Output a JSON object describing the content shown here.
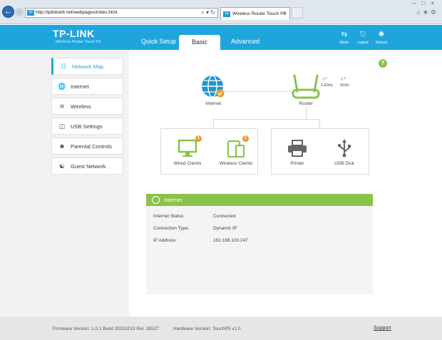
{
  "browser": {
    "url": "http://tplinkwifi.net/webpages/index.html",
    "tab_title": "Wireless Router Touch P5",
    "favicon_text": "TP"
  },
  "header": {
    "logo": "TP-LINK",
    "model": "Wireless Router Touch P5",
    "tabs": [
      "Quick Setup",
      "Basic",
      "Advanced"
    ],
    "tools": [
      {
        "label": "Mode",
        "icon": "mode-icon"
      },
      {
        "label": "Logout",
        "icon": "logout-icon"
      },
      {
        "label": "Reboot",
        "icon": "reboot-icon"
      }
    ]
  },
  "sidebar": {
    "items": [
      {
        "label": "Network Map",
        "icon": "network-map-icon",
        "active": true
      },
      {
        "label": "Internet",
        "icon": "globe-icon"
      },
      {
        "label": "Wireless",
        "icon": "wireless-icon"
      },
      {
        "label": "USB Settings",
        "icon": "usb-icon"
      },
      {
        "label": "Parental Controls",
        "icon": "parental-controls-icon"
      },
      {
        "label": "Guest Network",
        "icon": "guest-network-icon"
      }
    ]
  },
  "map": {
    "internet_label": "Internet",
    "router_label": "Router",
    "band_24": "2.4GHz",
    "band_5": "5GHz",
    "wired_label": "Wired Clients",
    "wired_count": "1",
    "wireless_label": "Wireless Clients",
    "wireless_count": "1",
    "printer_label": "Printer",
    "usb_label": "USB Disk"
  },
  "internet_panel": {
    "title": "Internet",
    "rows": [
      {
        "key": "Internet Status:",
        "value": "Connected"
      },
      {
        "key": "Connection Type:",
        "value": "Dynamic IP"
      },
      {
        "key": "IP Address:",
        "value": "192.168.100.247"
      }
    ]
  },
  "help_text": "?",
  "footer": {
    "firmware": "Firmware Version: 1.0.1 Build 20151013 Rel. 35527",
    "hardware": "Hardware Version: TouchP5 v1.0",
    "support": "Support"
  },
  "colors": {
    "brand_blue": "#1ea6dc",
    "accent_green": "#8bc34a",
    "badge_orange": "#f29a27"
  }
}
